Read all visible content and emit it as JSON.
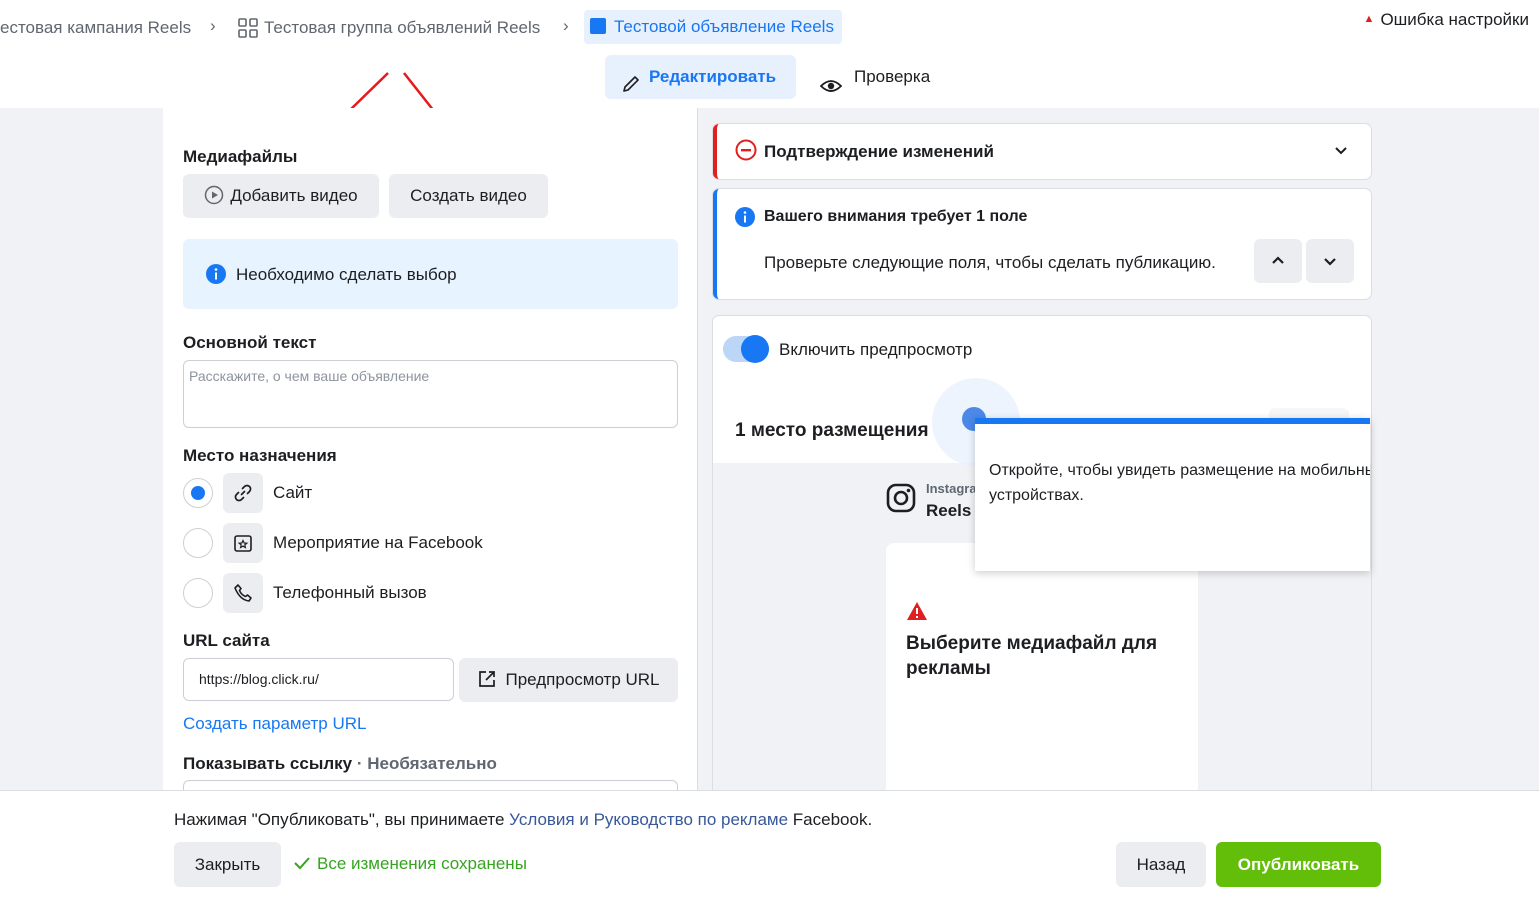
{
  "breadcrumb": {
    "campaign": "естовая кампания Reels",
    "adset": "Тестовая группа объявлений Reels",
    "ad": "Тестовой объявление Reels"
  },
  "header": {
    "error_label": "Ошибка настройки",
    "tab_edit": "Редактировать",
    "tab_review": "Проверка"
  },
  "form": {
    "media_label": "Медиафайлы",
    "add_video": "Добавить видео",
    "create_video": "Создать видео",
    "info_text": "Необходимо сделать выбор",
    "primary_text_label": "Основной текст",
    "primary_text_placeholder": "Расскажите, о чем ваше объявление",
    "destination_label": "Место назначения",
    "destinations": [
      {
        "label": "Сайт",
        "selected": true
      },
      {
        "label": "Мероприятие на Facebook",
        "selected": false
      },
      {
        "label": "Телефонный вызов",
        "selected": false
      }
    ],
    "url_label": "URL сайта",
    "url_value": "https://blog.click.ru/",
    "url_preview": "Предпросмотр URL",
    "url_param_link": "Создать параметр URL",
    "display_link_label": "Показывать ссылку",
    "display_link_optional": " · Необязательно"
  },
  "right": {
    "confirm_title": "Подтверждение изменений",
    "attention_title": "Вашего внимания требует 1 поле",
    "attention_desc": "Проверьте следующие поля, чтобы сделать публикацию.",
    "preview_toggle": "Включить предпросмотр",
    "placements_title": "1 место размещения",
    "instagram_small": "Instagram",
    "reels": "Reels",
    "popup_text": "Откройте, чтобы увидеть размещение на мобильных устройствах.",
    "select_media": "Выберите медиафайл для рекламы"
  },
  "footer": {
    "terms_prefix": "Нажимая \"Опубликовать\", вы принимаете ",
    "terms_link": "Условия и Руководство по рекламе",
    "terms_suffix": " Facebook.",
    "close": "Закрыть",
    "saved": "Все изменения сохранены",
    "back": "Назад",
    "publish": "Опубликовать"
  },
  "colors": {
    "accent": "#1877f2",
    "publish": "#63be09",
    "error": "#e02020",
    "annotation_arrow": "#e8191b"
  }
}
